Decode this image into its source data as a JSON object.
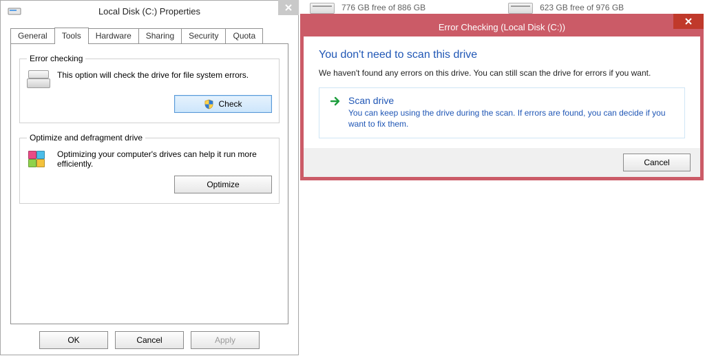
{
  "drives": [
    {
      "free_text": "776 GB free of 886 GB"
    },
    {
      "free_text": "623 GB free of 976 GB"
    }
  ],
  "prop": {
    "title": "Local Disk (C:) Properties",
    "tabs": [
      "General",
      "Tools",
      "Hardware",
      "Sharing",
      "Security",
      "Quota"
    ],
    "err": {
      "legend": "Error checking",
      "desc": "This option will check the drive for file system errors.",
      "btn": "Check"
    },
    "opt": {
      "legend": "Optimize and defragment drive",
      "desc": "Optimizing your computer's drives can help it run more efficiently.",
      "btn": "Optimize"
    },
    "buttons": {
      "ok": "OK",
      "cancel": "Cancel",
      "apply": "Apply"
    }
  },
  "ec": {
    "title": "Error Checking (Local Disk (C:))",
    "headline": "You don't need to scan this drive",
    "sub": "We haven't found any errors on this drive. You can still scan the drive for errors if you want.",
    "option_title": "Scan drive",
    "option_desc": "You can keep using the drive during the scan. If errors are found, you can decide if you want to fix them.",
    "cancel": "Cancel"
  }
}
